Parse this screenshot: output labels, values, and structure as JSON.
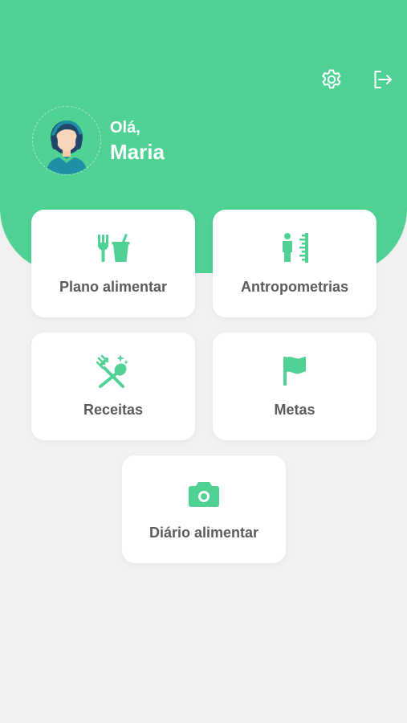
{
  "theme": {
    "primary_color": "#4fd294",
    "background_color": "#f1f1f1",
    "card_color": "#ffffff",
    "label_color": "#5b5b5b"
  },
  "header": {
    "greeting": "Olá,",
    "user_name": "Maria",
    "icons": [
      "gear-icon",
      "logout-icon"
    ]
  },
  "menu": [
    {
      "label": "Plano alimentar",
      "icon": "utensils-drink-icon"
    },
    {
      "label": "Antropometrias",
      "icon": "body-measure-icon"
    },
    {
      "label": "Receitas",
      "icon": "recipes-icon"
    },
    {
      "label": "Metas",
      "icon": "flag-icon"
    },
    {
      "label": "Diário alimentar",
      "icon": "camera-icon"
    }
  ]
}
